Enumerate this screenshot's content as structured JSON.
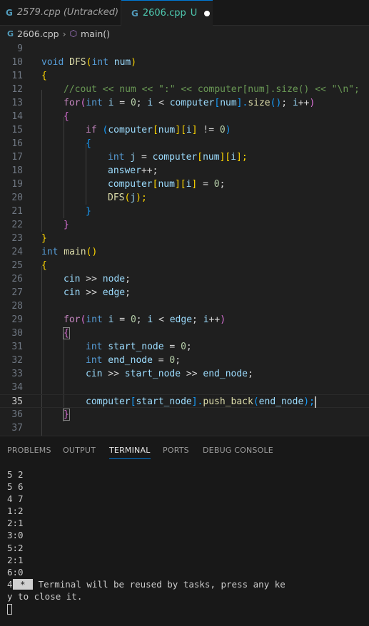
{
  "tabs": [
    {
      "icon": "G",
      "name": "2579.cpp (Untracked)"
    },
    {
      "icon": "G",
      "name": "2606.cpp",
      "status": "U"
    }
  ],
  "breadcrumb": {
    "file": "2606.cpp",
    "symbol": "main()"
  },
  "line_numbers": [
    "9",
    "10",
    "11",
    "12",
    "13",
    "14",
    "15",
    "16",
    "17",
    "18",
    "19",
    "20",
    "21",
    "22",
    "23",
    "24",
    "25",
    "26",
    "27",
    "28",
    "29",
    "30",
    "31",
    "32",
    "33",
    "34",
    "35",
    "36",
    "37"
  ],
  "code": {
    "l10": {
      "t1": "void",
      "t2": "DFS",
      "t3": "(",
      "t4": "int",
      "t5": " num",
      "t6": ")"
    },
    "l11": {
      "t1": "{"
    },
    "l12": {
      "t1": "//cout << num << \":\" << computer[num].size() << \"\\n\";"
    },
    "l13": {
      "t1": "for",
      "t2": "(",
      "t3": "int",
      "t4": " i",
      "t5": " = ",
      "t6": "0",
      "t7": "; ",
      "t8": "i",
      "t9": " < ",
      "t10": "computer",
      "t11": "[",
      "t12": "num",
      "t13": "].",
      "t14": "size",
      "t15": "()",
      "t16": "; ",
      "t17": "i",
      "t18": "++",
      "t19": ")"
    },
    "l14": {
      "t1": "{"
    },
    "l15": {
      "t1": "if",
      "t2": " (",
      "t3": "computer",
      "t4": "[",
      "t5": "num",
      "t6": "][",
      "t7": "i",
      "t8": "]",
      "t9": " != ",
      "t10": "0",
      "t11": ")"
    },
    "l16": {
      "t1": "{"
    },
    "l17": {
      "t1": "int",
      "t2": " j",
      "t3": " = ",
      "t4": "computer",
      "t5": "[",
      "t6": "num",
      "t7": "][",
      "t8": "i",
      "t9": "];"
    },
    "l18": {
      "t1": "answer",
      "t2": "++;"
    },
    "l19": {
      "t1": "computer",
      "t2": "[",
      "t3": "num",
      "t4": "][",
      "t5": "i",
      "t6": "]",
      "t7": " = ",
      "t8": "0",
      "t9": ";"
    },
    "l20": {
      "t1": "DFS",
      "t2": "(",
      "t3": "j",
      "t4": ");"
    },
    "l21": {
      "t1": "}"
    },
    "l22": {
      "t1": "}"
    },
    "l23": {
      "t1": "}"
    },
    "l24": {
      "t1": "int",
      "t2": " main",
      "t3": "()"
    },
    "l25": {
      "t1": "{"
    },
    "l26": {
      "t1": "cin",
      "t2": " >> ",
      "t3": "node",
      "t4": ";"
    },
    "l27": {
      "t1": "cin",
      "t2": " >> ",
      "t3": "edge",
      "t4": ";"
    },
    "l29": {
      "t1": "for",
      "t2": "(",
      "t3": "int",
      "t4": " i",
      "t5": " = ",
      "t6": "0",
      "t7": "; ",
      "t8": "i",
      "t9": " < ",
      "t10": "edge",
      "t11": "; ",
      "t12": "i",
      "t13": "++",
      "t14": ")"
    },
    "l30": {
      "t1": "{"
    },
    "l31": {
      "t1": "int",
      "t2": " start_node",
      "t3": " = ",
      "t4": "0",
      "t5": ";"
    },
    "l32": {
      "t1": "int",
      "t2": " end_node",
      "t3": " = ",
      "t4": "0",
      "t5": ";"
    },
    "l33": {
      "t1": "cin",
      "t2": " >> ",
      "t3": "start_node",
      "t4": " >> ",
      "t5": "end_node",
      "t6": ";"
    },
    "l35": {
      "t1": "computer",
      "t2": "[",
      "t3": "start_node",
      "t4": "].",
      "t5": "push_back",
      "t6": "(",
      "t7": "end_node",
      "t8": ");"
    },
    "l36": {
      "t1": "}"
    }
  },
  "panel": {
    "tabs": [
      "PROBLEMS",
      "OUTPUT",
      "TERMINAL",
      "PORTS",
      "DEBUG CONSOLE"
    ],
    "active_tab": "TERMINAL"
  },
  "terminal": {
    "lines": [
      "5 2",
      "5 6",
      "4 7",
      "1:2",
      "2:1",
      "3:0",
      "5:2",
      "2:1",
      "6:0"
    ],
    "prefix": "4",
    "star": " * ",
    "msg1": " Terminal will be reused by tasks, press any ke",
    "msg2": "y to close it."
  },
  "colors": {
    "accent": "#0078d4",
    "background": "#1f1f1f",
    "keyword": "#569cd6",
    "function": "#dcdcaa",
    "variable": "#9cdcfe"
  }
}
